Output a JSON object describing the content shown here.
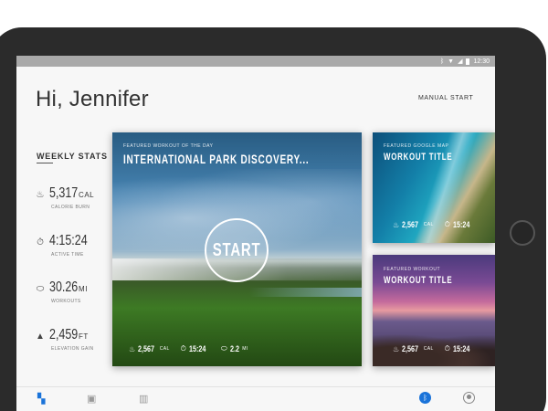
{
  "status_bar": {
    "time": "12:30",
    "icons": [
      "bluetooth-icon",
      "wifi-icon",
      "signal-icon",
      "battery-icon"
    ]
  },
  "header": {
    "greeting": "Hi, Jennifer",
    "manual_start": "MANUAL START"
  },
  "weekly_stats": {
    "title": "WEEKLY STATS",
    "items": [
      {
        "icon": "flame-icon",
        "value": "5,317",
        "unit": "CAL",
        "label": "CALORIE BURN"
      },
      {
        "icon": "stopwatch-icon",
        "value": "4:15:24",
        "unit": "",
        "label": "ACTIVE TIME"
      },
      {
        "icon": "shoe-icon",
        "value": "30.26",
        "unit": "MI",
        "label": "WORKOUTS"
      },
      {
        "icon": "mountain-icon",
        "value": "2,459",
        "unit": "FT",
        "label": "ELEVATION GAIN"
      }
    ]
  },
  "featured_main": {
    "kicker": "FEATURED WORKOUT OF THE DAY",
    "title": "INTERNATIONAL PARK DISCOVERY...",
    "start_label": "START",
    "stats": [
      {
        "icon": "flame-icon",
        "value": "2,567",
        "unit": "CAL"
      },
      {
        "icon": "stopwatch-icon",
        "value": "15:24",
        "unit": ""
      },
      {
        "icon": "shoe-icon",
        "value": "2.2",
        "unit": "MI"
      }
    ]
  },
  "featured_map": {
    "kicker": "FEATURED GOOGLE MAP",
    "title": "WORKOUT TITLE",
    "stats": [
      {
        "icon": "flame-icon",
        "value": "2,567",
        "unit": "CAL"
      },
      {
        "icon": "stopwatch-icon",
        "value": "15:24",
        "unit": ""
      }
    ]
  },
  "featured_workout": {
    "kicker": "FEATURED WORKOUT",
    "title": "WORKOUT TITLE",
    "stats": [
      {
        "icon": "flame-icon",
        "value": "2,567",
        "unit": "CAL"
      },
      {
        "icon": "stopwatch-icon",
        "value": "15:24",
        "unit": ""
      }
    ]
  },
  "bottom_nav": {
    "items": [
      "dashboard-icon",
      "calendar-icon",
      "map-icon",
      "bluetooth-icon",
      "profile-icon"
    ],
    "active": "dashboard-icon"
  },
  "colors": {
    "accent": "#1a73d9",
    "device_frame": "#2b2b2b",
    "background": "#f7f7f7"
  }
}
